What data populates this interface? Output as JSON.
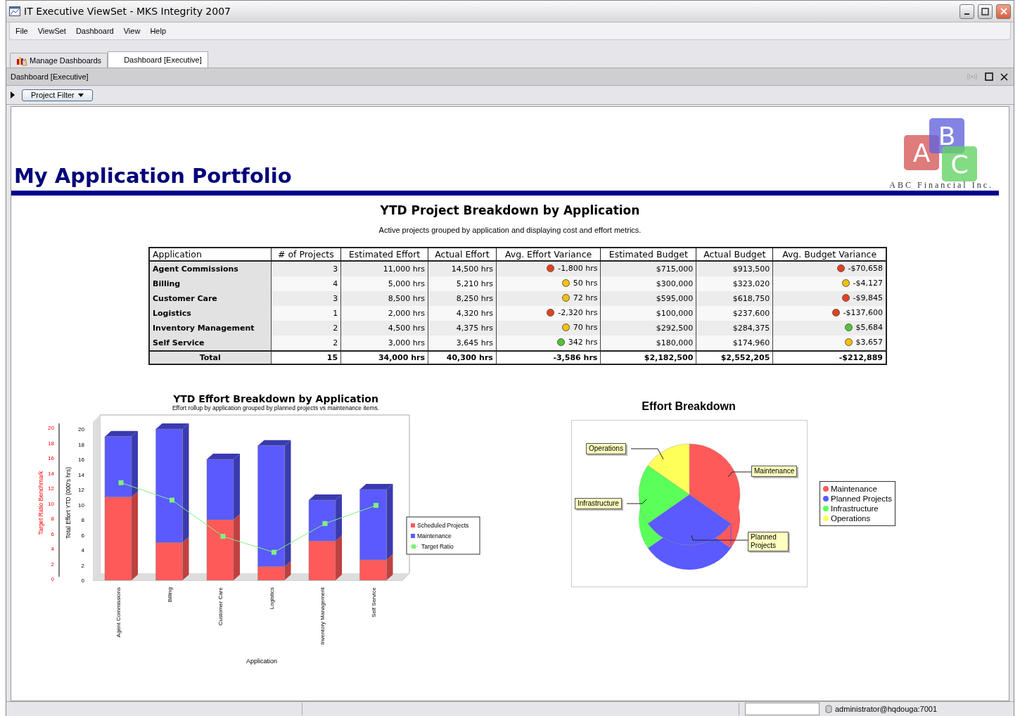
{
  "window": {
    "title": "IT Executive ViewSet - MKS Integrity 2007"
  },
  "menu": [
    "File",
    "ViewSet",
    "Dashboard",
    "View",
    "Help"
  ],
  "tabs": [
    {
      "label": "Manage Dashboards",
      "selected": false
    },
    {
      "label": "Dashboard [Executive]",
      "selected": true
    }
  ],
  "panel": {
    "title": "Dashboard [Executive]"
  },
  "toolbar": {
    "filter_button": "Project Filter"
  },
  "header": {
    "title": "My Application Portfolio",
    "logo": {
      "letters": [
        "A",
        "B",
        "C"
      ],
      "company": "ABC Financial Inc."
    }
  },
  "table_section": {
    "title": "YTD Project Breakdown by Application",
    "subtitle": "Active projects grouped by application and displaying cost and effort metrics."
  },
  "table": {
    "columns": [
      "Application",
      "# of Projects",
      "Estimated Effort",
      "Actual Effort",
      "Avg. Effort Variance",
      "Estimated Budget",
      "Actual Budget",
      "Avg. Budget Variance"
    ],
    "rows": [
      {
        "application": "Agent Commissions",
        "projects": "3",
        "estimated_effort": "11,000 hrs",
        "actual_effort": "14,500 hrs",
        "effort_variance": {
          "text": "-1,800 hrs",
          "color": "#e8401c"
        },
        "estimated_budget": "$715,000",
        "actual_budget": "$913,500",
        "budget_variance": {
          "text": "-$70,658",
          "color": "#e8401c"
        }
      },
      {
        "application": "Billing",
        "projects": "4",
        "estimated_effort": "5,000 hrs",
        "actual_effort": "5,210 hrs",
        "effort_variance": {
          "text": "50 hrs",
          "color": "#f4c20d"
        },
        "estimated_budget": "$300,000",
        "actual_budget": "$323,020",
        "budget_variance": {
          "text": "-$4,127",
          "color": "#f4c20d"
        }
      },
      {
        "application": "Customer Care",
        "projects": "3",
        "estimated_effort": "8,500 hrs",
        "actual_effort": "8,250 hrs",
        "effort_variance": {
          "text": "72 hrs",
          "color": "#f4c20d"
        },
        "estimated_budget": "$595,000",
        "actual_budget": "$618,750",
        "budget_variance": {
          "text": "-$9,845",
          "color": "#e8401c"
        }
      },
      {
        "application": "Logistics",
        "projects": "1",
        "estimated_effort": "2,000 hrs",
        "actual_effort": "4,320 hrs",
        "effort_variance": {
          "text": "-2,320 hrs",
          "color": "#e8401c"
        },
        "estimated_budget": "$100,000",
        "actual_budget": "$237,600",
        "budget_variance": {
          "text": "-$137,600",
          "color": "#e8401c"
        }
      },
      {
        "application": "Inventory Management",
        "projects": "2",
        "estimated_effort": "4,500 hrs",
        "actual_effort": "4,375 hrs",
        "effort_variance": {
          "text": "70 hrs",
          "color": "#f4c20d"
        },
        "estimated_budget": "$292,500",
        "actual_budget": "$284,375",
        "budget_variance": {
          "text": "$5,684",
          "color": "#52c530"
        }
      },
      {
        "application": "Self Service",
        "projects": "2",
        "estimated_effort": "3,000 hrs",
        "actual_effort": "3,645 hrs",
        "effort_variance": {
          "text": "342 hrs",
          "color": "#52c530"
        },
        "estimated_budget": "$180,000",
        "actual_budget": "$174,960",
        "budget_variance": {
          "text": "$3,657",
          "color": "#f4c20d"
        }
      }
    ],
    "total": {
      "label": "Total",
      "projects": "15",
      "estimated_effort": "34,000 hrs",
      "actual_effort": "40,300 hrs",
      "effort_variance": "-3,586 hrs",
      "estimated_budget": "$2,182,500",
      "actual_budget": "$2,552,205",
      "budget_variance": "-$212,889"
    }
  },
  "effort_chart": {
    "subtitle": "Effort rollup by application grouped by planned projects vs maintenance items.",
    "secondary_ylabel": "Target Ratio Benchmark",
    "secondary_yticks": [
      "20",
      "18",
      "16",
      "14",
      "12",
      "10",
      "8",
      "6",
      "4",
      "2",
      "0"
    ],
    "chart_data": {
      "type": "bar",
      "title": "YTD Effort Breakdown by Application",
      "xlabel": "Application",
      "ylabel": "Total Effort YTD (000's hrs)",
      "stacked": true,
      "legend": "right",
      "ylim": [
        0,
        20
      ],
      "yticks": [
        {
          "value": 0,
          "label": "0"
        },
        {
          "value": 2,
          "label": "2"
        },
        {
          "value": 4,
          "label": "4"
        },
        {
          "value": 6,
          "label": "6"
        },
        {
          "value": 8,
          "label": "8"
        },
        {
          "value": 10,
          "label": "10"
        },
        {
          "value": 12,
          "label": "12"
        },
        {
          "value": 14,
          "label": "14"
        },
        {
          "value": 16,
          "label": "16"
        },
        {
          "value": 18,
          "label": "18"
        },
        {
          "value": 20,
          "label": "20"
        }
      ],
      "categories": [
        "Agent Commissions",
        "Billing",
        "Customer Care",
        "Logistics",
        "Inventory Management",
        "Self Service"
      ],
      "series": [
        {
          "name": "Scheduled Projects",
          "type": "bar",
          "color": "#ff5a5a",
          "values": [
            11,
            5,
            8,
            1.8,
            5.2,
            2.7
          ]
        },
        {
          "name": "Maintenance",
          "type": "bar",
          "color": "#5a5aff",
          "values": [
            8,
            15,
            8,
            16,
            5.4,
            9.3
          ]
        },
        {
          "name": "Target Ratio",
          "type": "line",
          "marker": "square",
          "color": "#80f080",
          "values": [
            12.9,
            10.6,
            5.8,
            3.7,
            7.5,
            9.9
          ]
        }
      ]
    }
  },
  "pie_chart": {
    "title": "Effort Breakdown",
    "callouts": [
      "Operations",
      "Maintenance",
      "Infrastructure",
      "Planned Projects"
    ],
    "legend": [
      {
        "label": "Maintenance",
        "color": "#ff5a5a"
      },
      {
        "label": "Planned Projects",
        "color": "#5a5aff"
      },
      {
        "label": "Infrastructure",
        "color": "#5aff5a"
      },
      {
        "label": "Operations",
        "color": "#ffff5a"
      }
    ]
  },
  "status_bar": {
    "user": "administrator@hqdouga:7001"
  }
}
